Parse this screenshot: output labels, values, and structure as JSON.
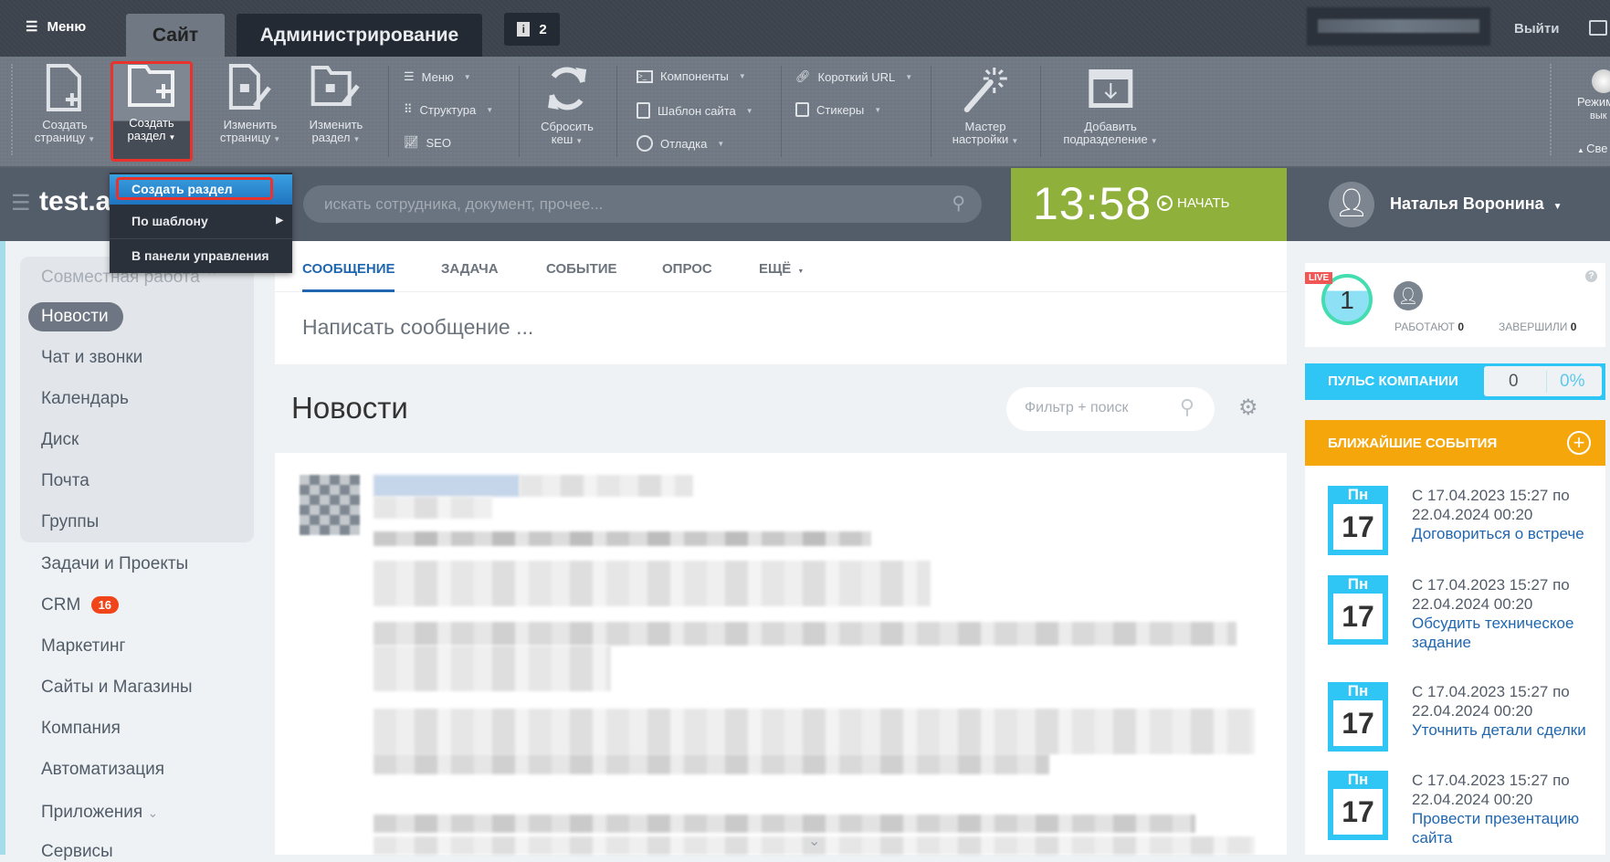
{
  "topbar": {
    "menu": "Меню",
    "tab_site": "Сайт",
    "tab_admin": "Администрирование",
    "notifications": "2",
    "logout": "Выйти"
  },
  "toolbar": {
    "create_page": [
      "Создать",
      "страницу"
    ],
    "create_section": [
      "Создать",
      "раздел"
    ],
    "edit_page": [
      "Изменить",
      "страницу"
    ],
    "edit_section": [
      "Изменить",
      "раздел"
    ],
    "menu": "Меню",
    "structure": "Структура",
    "seo": "SEO",
    "clear_cache": [
      "Сбросить",
      "кеш"
    ],
    "components": "Компоненты",
    "site_template": "Шаблон сайта",
    "debug": "Отладка",
    "short_url": "Короткий URL",
    "stickers": "Стикеры",
    "wizard": [
      "Мастер",
      "настройки"
    ],
    "add_department": [
      "Добавить",
      "подразделение"
    ],
    "mode": [
      "Режим",
      "вык"
    ],
    "collapse": "Све"
  },
  "dropdown": {
    "items": [
      "Создать раздел",
      "По шаблону",
      "В панели управления"
    ]
  },
  "header": {
    "logo": "test.a",
    "search_placeholder": "искать сотрудника, документ, прочее...",
    "time": "13:58",
    "start": "НАЧАТЬ",
    "user": "Наталья Воронина"
  },
  "sidebar": {
    "group": "Совместная работа",
    "items": [
      "Новости",
      "Чат и звонки",
      "Календарь",
      "Диск",
      "Почта",
      "Группы",
      "Задачи и Проекты",
      "CRM",
      "Маркетинг",
      "Сайты и Магазины",
      "Компания",
      "Автоматизация",
      "Приложения",
      "Сервисы"
    ],
    "crm_badge": "16"
  },
  "composer": {
    "tabs": [
      "СООБЩЕНИЕ",
      "ЗАДАЧА",
      "СОБЫТИЕ",
      "ОПРОС",
      "ЕЩЁ"
    ],
    "placeholder": "Написать сообщение ..."
  },
  "feed": {
    "title": "Новости",
    "filter_placeholder": "Фильтр + поиск"
  },
  "live": {
    "badge": "LIVE",
    "count": "1",
    "working_label": "РАБОТАЮТ",
    "working": "0",
    "done_label": "ЗАВЕРШИЛИ",
    "done": "0",
    "help": "?"
  },
  "pulse": {
    "label": "ПУЛЬС КОМПАНИИ",
    "value": "0",
    "percent": "0%"
  },
  "events": {
    "title": "БЛИЖАЙШИЕ СОБЫТИЯ",
    "items": [
      {
        "day": "Пн",
        "date": "17",
        "range1": "С 17.04.2023 15:27 по",
        "range2": "22.04.2024 00:20",
        "title": "Договориться о встрече"
      },
      {
        "day": "Пн",
        "date": "17",
        "range1": "С 17.04.2023 15:27 по",
        "range2": "22.04.2024 00:20",
        "title": "Обсудить техническое задание"
      },
      {
        "day": "Пн",
        "date": "17",
        "range1": "С 17.04.2023 15:27 по",
        "range2": "22.04.2024 00:20",
        "title": "Уточнить детали сделки"
      },
      {
        "day": "Пн",
        "date": "17",
        "range1": "С 17.04.2023 15:27 по",
        "range2": "22.04.2024 00:20",
        "title": "Провести презентацию сайта"
      }
    ]
  }
}
